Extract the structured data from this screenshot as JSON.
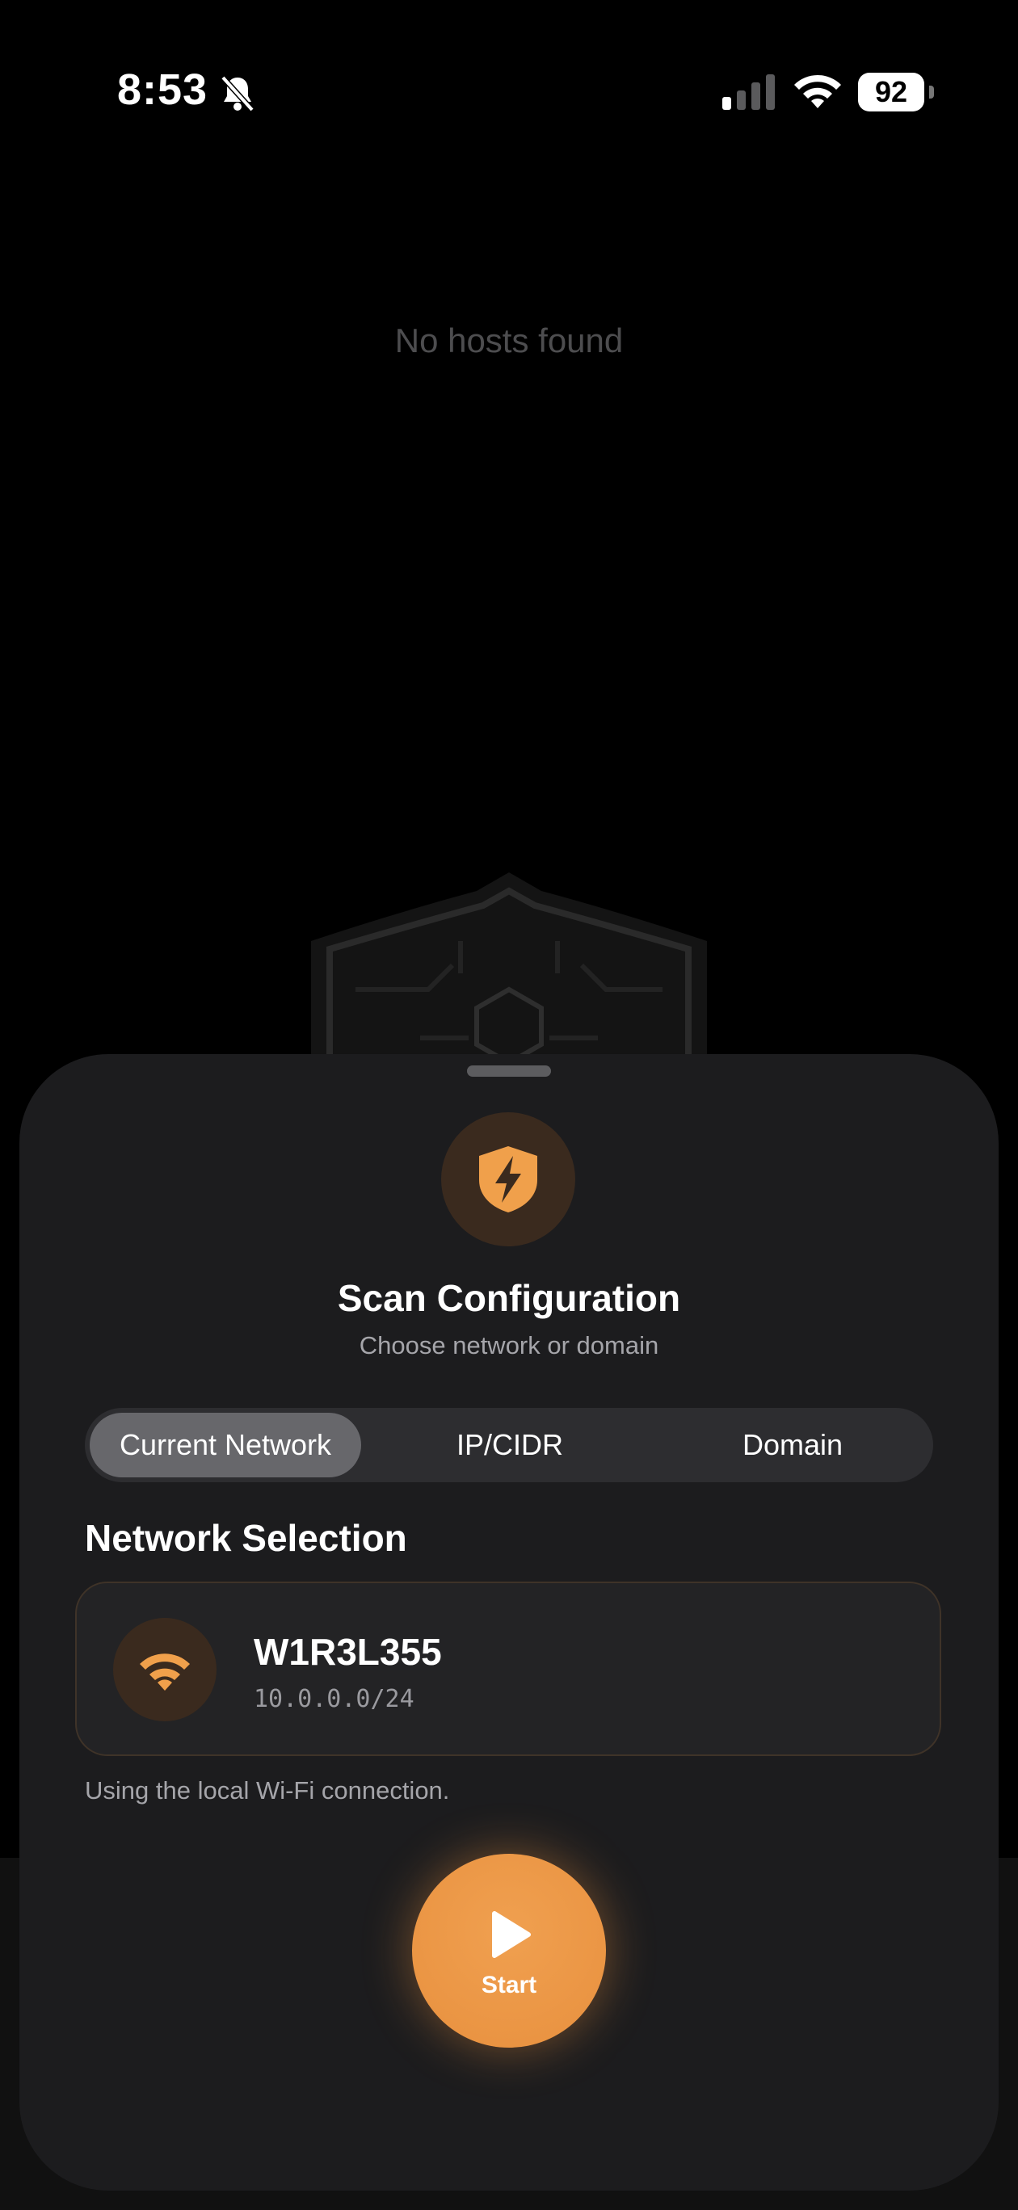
{
  "status": {
    "time": "8:53",
    "battery": "92"
  },
  "main": {
    "empty_message": "No hosts found"
  },
  "sheet": {
    "title": "Scan Configuration",
    "subtitle": "Choose network or domain",
    "tabs": [
      {
        "label": "Current Network",
        "selected": true
      },
      {
        "label": "IP/CIDR",
        "selected": false
      },
      {
        "label": "Domain",
        "selected": false
      }
    ],
    "section_title": "Network Selection",
    "network": {
      "name": "W1R3L355",
      "cidr": "10.0.0.0/24",
      "icon": "wifi-icon"
    },
    "hint": "Using the local Wi-Fi connection.",
    "start_label": "Start"
  },
  "colors": {
    "accent": "#E8903E",
    "sheet_bg": "#1C1C1E",
    "background": "#000000"
  }
}
